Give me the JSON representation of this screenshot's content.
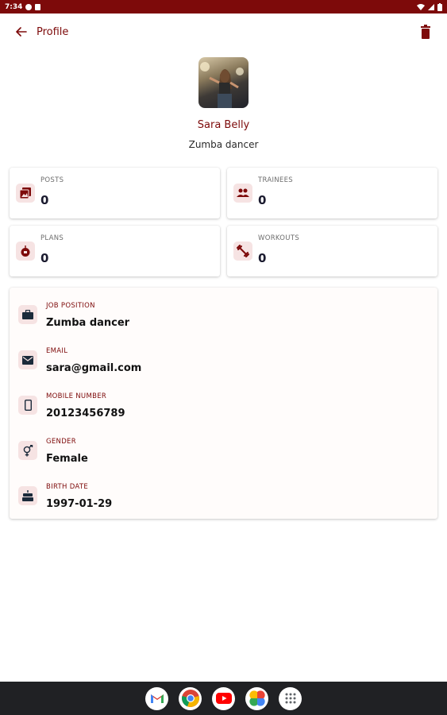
{
  "status_bar": {
    "time": "7:34"
  },
  "app_bar": {
    "title": "Profile",
    "back_icon": "arrow-left-icon",
    "delete_icon": "trash-icon"
  },
  "profile": {
    "name": "Sara Belly",
    "role": "Zumba dancer"
  },
  "stats": [
    {
      "label": "POSTS",
      "value": "0",
      "icon": "image-icon"
    },
    {
      "label": "TRAINEES",
      "value": "0",
      "icon": "people-icon"
    },
    {
      "label": "PLANS",
      "value": "0",
      "icon": "apple-icon"
    },
    {
      "label": "WORKOUTS",
      "value": "0",
      "icon": "dumbbell-icon"
    }
  ],
  "details": [
    {
      "label": "JOB POSITION",
      "value": "Zumba dancer",
      "icon": "briefcase-icon"
    },
    {
      "label": "EMAIL",
      "value": "sara@gmail.com",
      "icon": "mail-icon"
    },
    {
      "label": "MOBILE NUMBER",
      "value": "20123456789",
      "icon": "phone-icon"
    },
    {
      "label": "GENDER",
      "value": "Female",
      "icon": "gender-icon"
    },
    {
      "label": "BIRTH DATE",
      "value": "1997-01-29",
      "icon": "cake-icon"
    }
  ],
  "dock": [
    "gmail-icon",
    "chrome-icon",
    "youtube-icon",
    "photos-icon",
    "app-drawer-icon"
  ],
  "colors": {
    "primary": "#7d0a0a",
    "icon_bg": "#f6e3e3",
    "nav_bg": "#202124"
  }
}
